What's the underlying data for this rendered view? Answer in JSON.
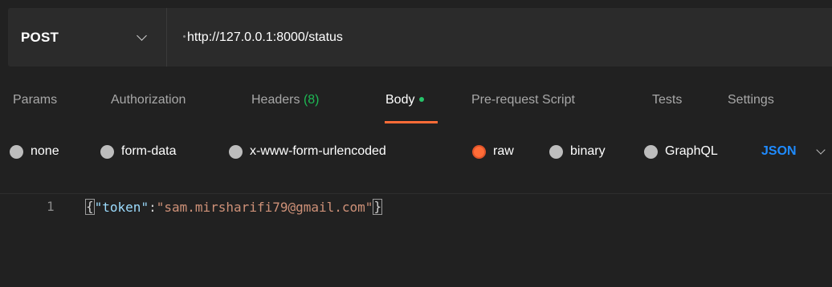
{
  "request": {
    "method": "POST",
    "url": "http://127.0.0.1:8000/status"
  },
  "tabs": [
    {
      "label": "Params"
    },
    {
      "label": "Authorization"
    },
    {
      "label": "Headers",
      "count": "(8)"
    },
    {
      "label": "Body"
    },
    {
      "label": "Pre-request Script"
    },
    {
      "label": "Tests"
    },
    {
      "label": "Settings"
    }
  ],
  "body_types": [
    {
      "label": "none"
    },
    {
      "label": "form-data"
    },
    {
      "label": "x-www-form-urlencoded"
    },
    {
      "label": "raw"
    },
    {
      "label": "binary"
    },
    {
      "label": "GraphQL"
    }
  ],
  "selected_body_type": "raw",
  "format": "JSON",
  "editor": {
    "line_number": "1",
    "open_brace": "{",
    "key": "\"token\"",
    "colon": ":",
    "value": "\"sam.mirsharifi79@gmail.com\"",
    "close_brace": "}"
  },
  "colors": {
    "accent": "#ff6c37",
    "status_green": "#26c46a",
    "link_blue": "#1f8bff",
    "background": "#212121"
  }
}
